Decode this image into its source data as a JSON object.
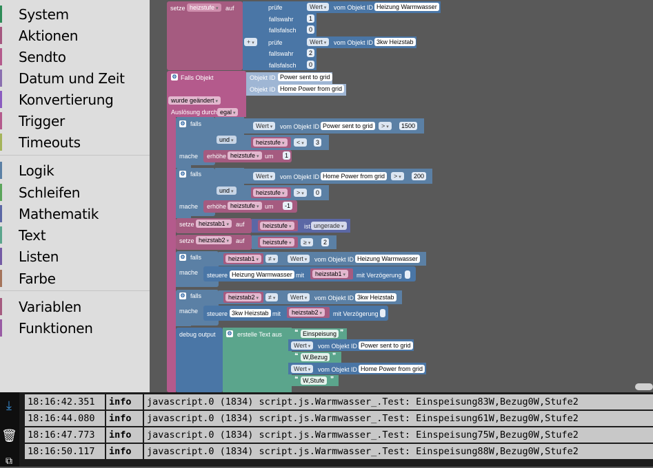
{
  "toolbox": {
    "categories": [
      {
        "label": "System",
        "color": "#2e8b57"
      },
      {
        "label": "Aktionen",
        "color": "#a5577f"
      },
      {
        "label": "Sendto",
        "color": "#b45a8c"
      },
      {
        "label": "Datum und Zeit",
        "color": "#8a6fb0"
      },
      {
        "label": "Konvertierung",
        "color": "#8a5cc0"
      },
      {
        "label": "Trigger",
        "color": "#b45a8c"
      },
      {
        "label": "Timeouts",
        "color": "#a5b45a"
      },
      {
        "label": "Logik",
        "color": "#5b80a5"
      },
      {
        "label": "Schleifen",
        "color": "#5ba55b"
      },
      {
        "label": "Mathematik",
        "color": "#5b67a5"
      },
      {
        "label": "Text",
        "color": "#5ba58c"
      },
      {
        "label": "Listen",
        "color": "#745ba5"
      },
      {
        "label": "Farbe",
        "color": "#a5745b"
      },
      {
        "label": "Variablen",
        "color": "#a55b80"
      },
      {
        "label": "Funktionen",
        "color": "#995ba5"
      }
    ]
  },
  "blocks": {
    "set1": {
      "setze": "setze",
      "var": "heizstufe",
      "auf": "auf"
    },
    "switch": {
      "pruefe": "prüfe",
      "wert": "Wert",
      "vom": "vom Objekt ID",
      "obj1": "Heizung Warmwasser",
      "fallswahr": "fallswahr",
      "v1": "1",
      "fallsfalsch": "fallsfalsch",
      "v0": "0",
      "plus": "+",
      "obj2": "3kw Heizstab",
      "v2": "2",
      "v0b": "0"
    },
    "trigger": {
      "label": "Falls Objekt",
      "objid": "Objekt ID",
      "o1": "Power sent to grid",
      "o2": "Home Power from grid",
      "changed": "wurde geändert",
      "ausloesung": "Auslösung durch",
      "egal": "egal"
    },
    "if1": {
      "falls": "falls",
      "wert": "Wert",
      "vom": "vom Objekt ID",
      "obj": "Power sent to grid",
      "op": ">",
      "num": "1500",
      "und": "und",
      "var": "heizstufe",
      "op2": "<",
      "num2": "3",
      "mache": "mache",
      "erhoehe": "erhöhe",
      "var2": "heizstufe",
      "um": "um",
      "n": "1"
    },
    "if2": {
      "falls": "falls",
      "wert": "Wert",
      "vom": "vom Objekt ID",
      "obj": "Home Power from grid",
      "op": ">",
      "num": "200",
      "und": "und",
      "var": "heizstufe",
      "op2": ">",
      "num2": "0",
      "mache": "mache",
      "erhoehe": "erhöhe",
      "var2": "heizstufe",
      "um": "um",
      "n": "-1"
    },
    "set2": {
      "setze": "setze",
      "var": "heizstab1",
      "auf": "auf",
      "var2": "heizstufe",
      "ist": "ist",
      "dd": "ungerade"
    },
    "set3": {
      "setze": "setze",
      "var": "heizstab2",
      "auf": "auf",
      "var2": "heizstufe",
      "op": "≥",
      "num": "2"
    },
    "if3": {
      "falls": "falls",
      "var": "heizstab1",
      "op": "≠",
      "wert": "Wert",
      "vom": "vom Objekt ID",
      "obj": "Heizung Warmwasser",
      "mache": "mache",
      "steuere": "steuere",
      "obj2": "Heizung Warmwasser",
      "mit": "mit",
      "var2": "heizstab1",
      "verz": "mit Verzögerung"
    },
    "if4": {
      "falls": "falls",
      "var": "heizstab2",
      "op": "≠",
      "wert": "Wert",
      "vom": "vom Objekt ID",
      "obj": "3kw Heizstab",
      "mache": "mache",
      "steuere": "steuere",
      "obj2": "3kw Heizstab",
      "mit": "mit",
      "var2": "heizstab2",
      "verz": "mit Verzögerung"
    },
    "debug": {
      "label": "debug output",
      "erstelle": "erstelle Text aus",
      "s1": "Einspeisung",
      "wert": "Wert",
      "vom": "vom Objekt ID",
      "o1": "Power sent to grid",
      "s2": "W,Bezug",
      "wert2": "Wert",
      "o2": "Home Power from grid",
      "s3": "W,Stufe"
    }
  },
  "console": {
    "rows": [
      {
        "time": "18:16:42.351",
        "level": "info",
        "msg": "javascript.0 (1834) script.js.Warmwasser_.Test: Einspeisung83W,Bezug0W,Stufe2"
      },
      {
        "time": "18:16:44.080",
        "level": "info",
        "msg": "javascript.0 (1834) script.js.Warmwasser_.Test: Einspeisung61W,Bezug0W,Stufe2"
      },
      {
        "time": "18:16:47.773",
        "level": "info",
        "msg": "javascript.0 (1834) script.js.Warmwasser_.Test: Einspeisung75W,Bezug0W,Stufe2"
      },
      {
        "time": "18:16:50.117",
        "level": "info",
        "msg": "javascript.0 (1834) script.js.Warmwasser_.Test: Einspeisung88W,Bezug0W,Stufe2"
      }
    ],
    "icons": [
      "scroll-down-icon",
      "clear-log-icon",
      "copy-icon"
    ]
  },
  "colors": {
    "variables": "#a55b80",
    "logic": "#5b80a5",
    "text": "#5ba58c",
    "system": "#4a76a6",
    "trigger": "#b45a8c"
  }
}
